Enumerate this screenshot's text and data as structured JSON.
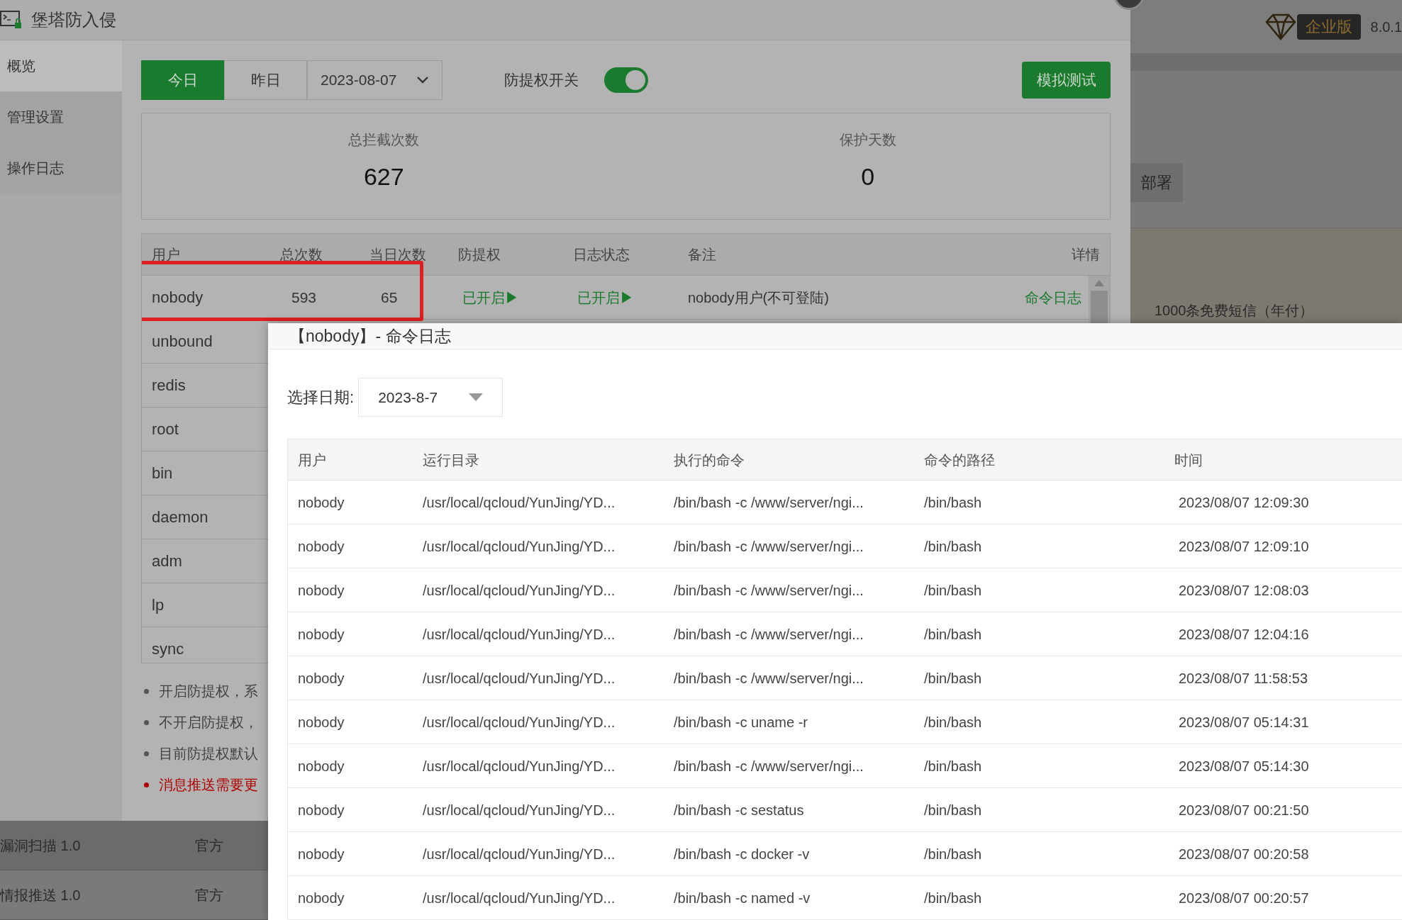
{
  "app_title": "堡塔防入侵",
  "edition": {
    "label": "企业版"
  },
  "version": "8.0.1",
  "sidebar": {
    "items": [
      {
        "label": "概览",
        "selected": true
      },
      {
        "label": "管理设置",
        "selected": false
      },
      {
        "label": "操作日志",
        "selected": false
      }
    ]
  },
  "day_tabs": [
    {
      "label": "今日",
      "selected": true
    },
    {
      "label": "昨日",
      "selected": false
    }
  ],
  "date_select": {
    "value": "2023-08-07"
  },
  "privilege_switch": {
    "label": "防提权开关",
    "on": true
  },
  "simulate_button": "模拟测试",
  "stats": [
    {
      "label": "总拦截次数",
      "value": "627"
    },
    {
      "label": "保护天数",
      "value": "0"
    }
  ],
  "users_table": {
    "columns": [
      "用户",
      "总次数",
      "当日次数",
      "防提权",
      "日志状态",
      "备注",
      "详情"
    ],
    "rows": [
      {
        "user": "nobody",
        "total": "593",
        "today": "65",
        "privilege": "已开启▶",
        "log_status": "已开启▶",
        "note": "nobody用户(不可登陆)",
        "detail": "命令日志",
        "highlighted": true
      },
      {
        "user": "unbound",
        "highlighted": false
      },
      {
        "user": "redis",
        "highlighted": false
      },
      {
        "user": "root",
        "highlighted": false
      },
      {
        "user": "bin",
        "highlighted": false
      },
      {
        "user": "daemon",
        "highlighted": false
      },
      {
        "user": "adm",
        "highlighted": false
      },
      {
        "user": "lp",
        "highlighted": false
      },
      {
        "user": "sync",
        "highlighted": false
      }
    ]
  },
  "notes": [
    {
      "text": "开启防提权，系",
      "kind": "info"
    },
    {
      "text": "不开启防提权，",
      "kind": "info"
    },
    {
      "text": "目前防提权默认",
      "kind": "info"
    },
    {
      "text": "消息推送需要更",
      "kind": "warning"
    }
  ],
  "background": {
    "deploy_button": "部署",
    "sms_offer": "1000条免费短信（年付）",
    "plugins": [
      {
        "name": "漏洞扫描 1.0",
        "author": "官方"
      },
      {
        "name": "情报推送 1.0",
        "author": "官方"
      }
    ]
  },
  "dialog": {
    "title": "【nobody】- 命令日志",
    "date_label": "选择日期:",
    "date_value": "2023-8-7",
    "columns": [
      "用户",
      "运行目录",
      "执行的命令",
      "命令的路径",
      "时间"
    ],
    "rows": [
      [
        "nobody",
        "/usr/local/qcloud/YunJing/YD...",
        "/bin/bash -c /www/server/ngi...",
        "/bin/bash",
        "2023/08/07 12:09:30"
      ],
      [
        "nobody",
        "/usr/local/qcloud/YunJing/YD...",
        "/bin/bash -c /www/server/ngi...",
        "/bin/bash",
        "2023/08/07 12:09:10"
      ],
      [
        "nobody",
        "/usr/local/qcloud/YunJing/YD...",
        "/bin/bash -c /www/server/ngi...",
        "/bin/bash",
        "2023/08/07 12:08:03"
      ],
      [
        "nobody",
        "/usr/local/qcloud/YunJing/YD...",
        "/bin/bash -c /www/server/ngi...",
        "/bin/bash",
        "2023/08/07 12:04:16"
      ],
      [
        "nobody",
        "/usr/local/qcloud/YunJing/YD...",
        "/bin/bash -c /www/server/ngi...",
        "/bin/bash",
        "2023/08/07 11:58:53"
      ],
      [
        "nobody",
        "/usr/local/qcloud/YunJing/YD...",
        "/bin/bash -c uname -r",
        "/bin/bash",
        "2023/08/07 05:14:31"
      ],
      [
        "nobody",
        "/usr/local/qcloud/YunJing/YD...",
        "/bin/bash -c /www/server/ngi...",
        "/bin/bash",
        "2023/08/07 05:14:30"
      ],
      [
        "nobody",
        "/usr/local/qcloud/YunJing/YD...",
        "/bin/bash -c sestatus",
        "/bin/bash",
        "2023/08/07 00:21:50"
      ],
      [
        "nobody",
        "/usr/local/qcloud/YunJing/YD...",
        "/bin/bash -c docker -v",
        "/bin/bash",
        "2023/08/07 00:20:58"
      ],
      [
        "nobody",
        "/usr/local/qcloud/YunJing/YD...",
        "/bin/bash -c named -v",
        "/bin/bash",
        "2023/08/07 00:20:57"
      ]
    ]
  }
}
